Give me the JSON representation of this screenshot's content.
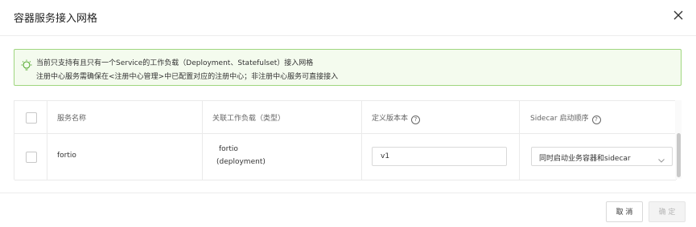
{
  "dialog": {
    "title": "容器服务接入网格"
  },
  "notice": {
    "line1": "当前只支持有且只有一个Service的工作负载（Deployment、Statefulset）接入网格",
    "line2": "注册中心服务需确保在<注册中心管理>中已配置对应的注册中心；非注册中心服务可直接接入"
  },
  "table": {
    "headers": {
      "service_name": "服务名称",
      "workload": "关联工作负载（类型）",
      "version": "定义版本本",
      "sidecar_order": "Sidecar 启动顺序"
    },
    "rows": [
      {
        "service_name": "fortio",
        "workload_name": "fortio",
        "workload_type": "(deployment)",
        "version_value": "v1",
        "sidecar_order": "同时启动业务容器和sidecar"
      }
    ]
  },
  "footer": {
    "cancel_label": "取 消",
    "ok_label": "确 定"
  },
  "colors": {
    "notice_bg": "#f4fbee",
    "notice_border": "#9fd67f",
    "bulb": "#52a82c"
  },
  "icons": {
    "close": "close-icon",
    "bulb": "lightbulb-icon",
    "help": "help-circle-icon",
    "chevron": "chevron-down-icon"
  }
}
